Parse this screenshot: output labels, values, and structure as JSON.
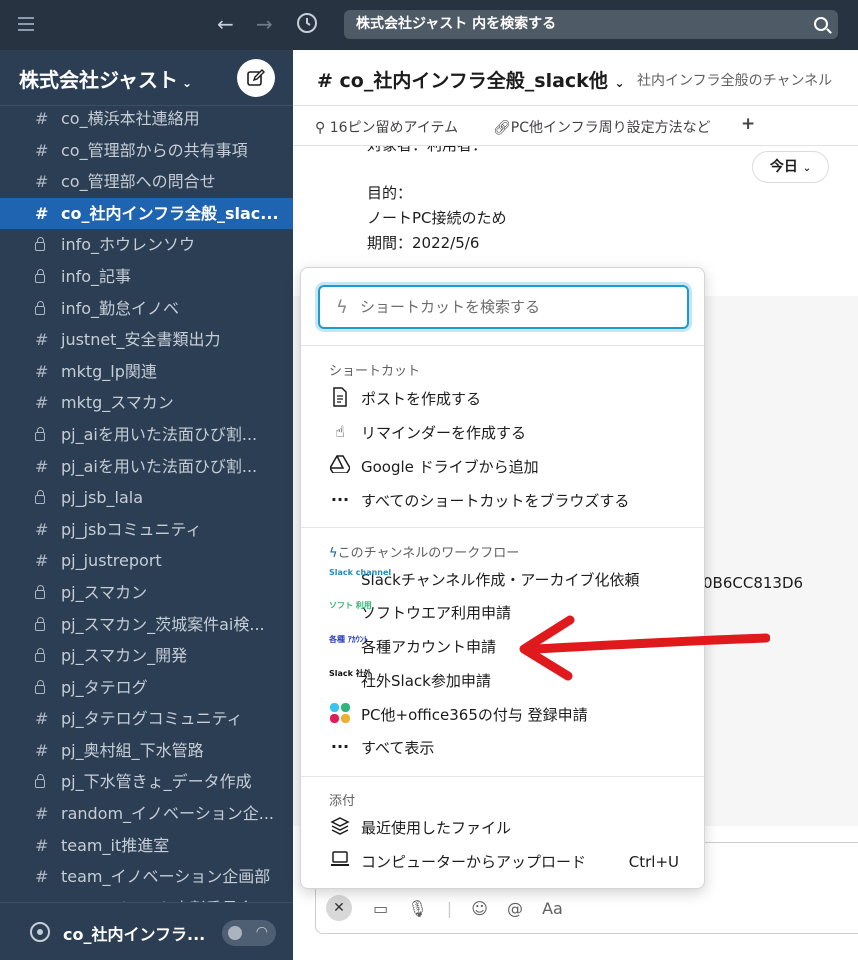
{
  "topbar": {
    "back_icon": "arrow-left-icon",
    "forward_icon": "arrow-right-icon",
    "history_icon": "clock-icon",
    "search_text": "株式会社ジャスト 内を検索する"
  },
  "sidebar": {
    "workspace_name": "株式会社ジャスト",
    "channels": [
      {
        "type": "hash",
        "name": "co_横浜本社連絡用"
      },
      {
        "type": "hash",
        "name": "co_管理部からの共有事項"
      },
      {
        "type": "hash",
        "name": "co_管理部への問合せ"
      },
      {
        "type": "hash",
        "name": "co_社内インフラ全般_slac...",
        "active": true
      },
      {
        "type": "lock",
        "name": "info_ホウレンソウ"
      },
      {
        "type": "lock",
        "name": "info_記事"
      },
      {
        "type": "lock",
        "name": "info_勤怠イノベ"
      },
      {
        "type": "hash",
        "name": "justnet_安全書類出力"
      },
      {
        "type": "hash",
        "name": "mktg_lp関連"
      },
      {
        "type": "hash",
        "name": "mktg_スマカン"
      },
      {
        "type": "lock",
        "name": "pj_aiを用いた法面ひび割..."
      },
      {
        "type": "hash",
        "name": "pj_aiを用いた法面ひび割..."
      },
      {
        "type": "lock",
        "name": "pj_jsb_lala"
      },
      {
        "type": "hash",
        "name": "pj_jsbコミュニティ"
      },
      {
        "type": "hash",
        "name": "pj_justreport"
      },
      {
        "type": "lock",
        "name": "pj_スマカン"
      },
      {
        "type": "lock",
        "name": "pj_スマカン_茨城案件ai検..."
      },
      {
        "type": "lock",
        "name": "pj_スマカン_開発"
      },
      {
        "type": "lock",
        "name": "pj_タテログ"
      },
      {
        "type": "hash",
        "name": "pj_タテログコミュニティ"
      },
      {
        "type": "hash",
        "name": "pj_奥村組_下水管路"
      },
      {
        "type": "lock",
        "name": "pj_下水管きょ_データ作成"
      },
      {
        "type": "hash",
        "name": "random_イノベーション企..."
      },
      {
        "type": "hash",
        "name": "team_it推進室"
      },
      {
        "type": "hash",
        "name": "team_イノベーション企画部"
      },
      {
        "type": "hash",
        "name": "team_ジャスト表彰委員会"
      }
    ],
    "huddle_label": "co_社内インフラ..."
  },
  "channel": {
    "title": "# co_社内インフラ全般_slack他",
    "description": "社内インフラ全般のチャンネル",
    "bookmarks": [
      {
        "icon": "pin-icon",
        "label": "16ピン留めアイテム"
      },
      {
        "icon": "link-icon",
        "label": "PC他インフラ周り設定方法など"
      },
      {
        "icon": "plus-icon",
        "label": "+"
      }
    ],
    "messages": [
      "対象者：利用者：",
      "目的：",
      "ノートPC接続のため",
      "期間：2022/5/6"
    ],
    "today_label": "今日",
    "right_text": "0B6CC813D6"
  },
  "popup": {
    "search_placeholder": "ショートカットを検索する",
    "section_shortcuts": "ショートカット",
    "shortcuts": [
      {
        "icon": "document-icon",
        "label": "ポストを作成する"
      },
      {
        "icon": "hand-pointer-icon",
        "label": "リマインダーを作成する"
      },
      {
        "icon": "google-drive-icon",
        "label": "Google ドライブから追加"
      },
      {
        "icon": "ellipsis-icon",
        "label": "すべてのショートカットをブラウズする"
      }
    ],
    "section_workflows": "このチャンネルのワークフロー",
    "workflows": [
      {
        "icon": "slack-channel-icon",
        "label": "Slackチャンネル作成・アーカイブ化依頼",
        "icon_text": "Slack channel",
        "color": "#1f8ac0"
      },
      {
        "icon": "software-icon",
        "label": "ソフトウエア利用申請",
        "icon_text": "ソフト 利用",
        "color": "#2bb673"
      },
      {
        "icon": "account-icon",
        "label": "各種アカウント申請",
        "icon_text": "各種 ｱｶｳﾝﾄ",
        "color": "#2b3fc0"
      },
      {
        "icon": "external-slack-icon",
        "label": "社外Slack参加申請",
        "icon_text": "Slack 社外",
        "color": "#111111"
      },
      {
        "icon": "office-grid-icon",
        "label": "PC他+office365の付与 登録申請"
      },
      {
        "icon": "ellipsis-icon",
        "label": "すべて表示"
      }
    ],
    "section_attach": "添付",
    "attachments": [
      {
        "icon": "layers-icon",
        "label": "最近使用したファイル"
      },
      {
        "icon": "laptop-icon",
        "label": "コンピューターからアップロード",
        "shortcut": "Ctrl+U"
      }
    ]
  },
  "colors": {
    "sidebar_bg": "#2c3e54",
    "active_channel": "#1f64b0",
    "arrow": "#e0191c"
  }
}
